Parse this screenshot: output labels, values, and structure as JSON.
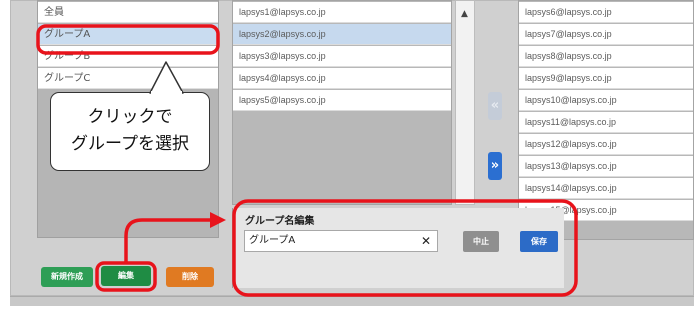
{
  "groups": {
    "items": [
      "全員",
      "グループA",
      "グループB",
      "グループC"
    ]
  },
  "members": {
    "items": [
      "lapsys1@lapsys.co.jp",
      "lapsys2@lapsys.co.jp",
      "lapsys3@lapsys.co.jp",
      "lapsys4@lapsys.co.jp",
      "lapsys5@lapsys.co.jp"
    ]
  },
  "candidates": {
    "items": [
      "lapsys6@lapsys.co.jp",
      "lapsys7@lapsys.co.jp",
      "lapsys8@lapsys.co.jp",
      "lapsys9@lapsys.co.jp",
      "lapsys10@lapsys.co.jp",
      "lapsys11@lapsys.co.jp",
      "lapsys12@lapsys.co.jp",
      "lapsys13@lapsys.co.jp",
      "lapsys14@lapsys.co.jp",
      "lapsys15@lapsys.co.jp"
    ]
  },
  "transfer": {
    "left_icon": "«",
    "right_icon": "»"
  },
  "scroll_up_icon": "▲",
  "buttons": {
    "new": "新規作成",
    "edit": "編集",
    "delete": "削除"
  },
  "editor": {
    "title": "グループ名編集",
    "value": "グループA",
    "clear_icon": "✕",
    "cancel": "中止",
    "save": "保存"
  },
  "callout": {
    "line1": "クリックで",
    "line2": "グループを選択"
  },
  "colors": {
    "highlight": "#e8131b",
    "selection": "#c9dcf0",
    "save": "#2c6bc7",
    "edit": "#1f8c44",
    "delete": "#e07a22"
  }
}
